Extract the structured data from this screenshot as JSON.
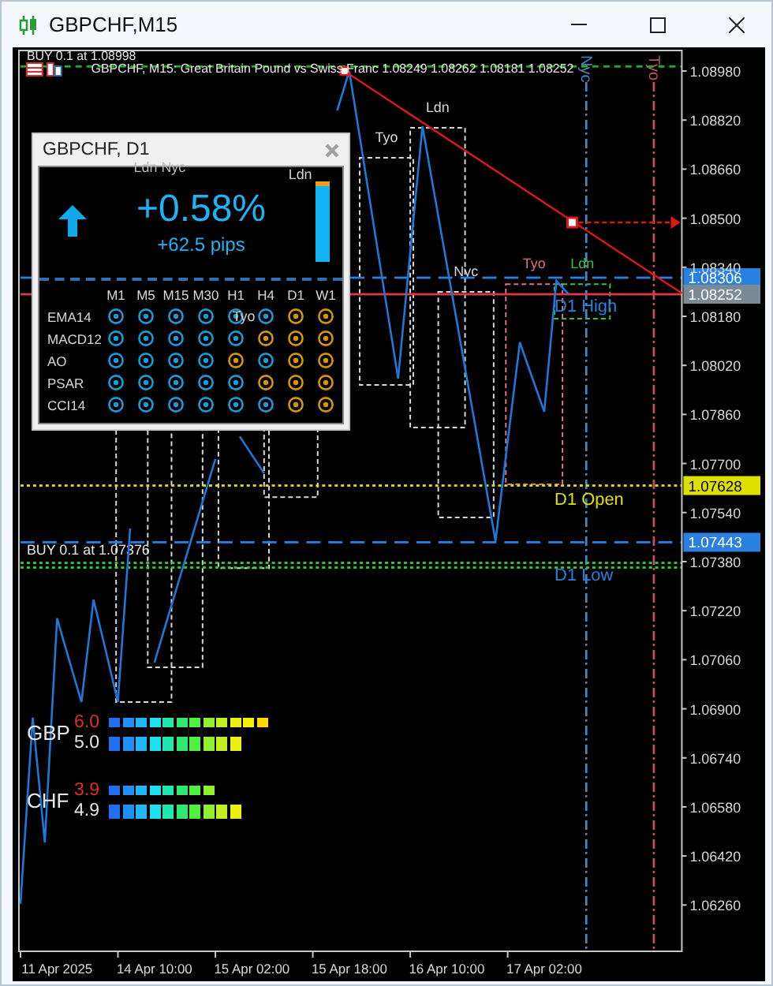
{
  "window": {
    "title": "GBPCHF,M15"
  },
  "chart": {
    "header": "GBPCHF, M15:  Great Britain Pound vs Swiss Franc  1.08249 1.08262 1.08181 1.08252",
    "chart_data": {
      "type": "line",
      "ylim": [
        1.06109,
        1.09047
      ],
      "categories": [
        null,
        null,
        null,
        "11 Apr 2025",
        null,
        null,
        null,
        null,
        null,
        null,
        null,
        "14 Apr 10:00",
        null,
        null,
        null,
        null,
        null,
        null,
        null,
        "15 Apr 02:00",
        null,
        null,
        null,
        null,
        null,
        null,
        null,
        "15 Apr 18:00",
        null,
        null,
        null,
        null,
        null,
        null,
        null,
        "16 Apr 10:00",
        null,
        null,
        null,
        null,
        null,
        null,
        null,
        "17 Apr 02:00",
        null,
        null,
        null,
        null,
        null,
        null,
        null,
        null,
        null,
        null,
        null
      ],
      "yticks": [
        {
          "value": 1.0898,
          "label": "1.08980"
        },
        {
          "value": 1.0882,
          "label": "1.08820"
        },
        {
          "value": 1.0866,
          "label": "1.08660"
        },
        {
          "value": 1.085,
          "label": "1.08500"
        },
        {
          "value": 1.0834,
          "label": "1.08340"
        },
        {
          "value": 1.0818,
          "label": "1.08180"
        },
        {
          "value": 1.0802,
          "label": "1.08020"
        },
        {
          "value": 1.0786,
          "label": "1.07860"
        },
        {
          "value": 1.077,
          "label": "1.07700"
        },
        {
          "value": 1.0754,
          "label": "1.07540"
        },
        {
          "value": 1.0738,
          "label": "1.07380"
        },
        {
          "value": 1.0722,
          "label": "1.07220"
        },
        {
          "value": 1.0706,
          "label": "1.07060"
        },
        {
          "value": 1.069,
          "label": "1.06900"
        },
        {
          "value": 1.0674,
          "label": "1.06740"
        },
        {
          "value": 1.0658,
          "label": "1.06580"
        },
        {
          "value": 1.0642,
          "label": "1.06420"
        },
        {
          "value": 1.0626,
          "label": "1.06260"
        }
      ],
      "series": [
        {
          "color": "#1e78d8",
          "values": [
            1.06264,
            1.06871,
            1.06464,
            1.07195,
            1.07059,
            1.06922,
            1.07256,
            1.07089,
            1.06922,
            1.07488,
            null,
            1.07051,
            1.07184,
            1.07317,
            1.0745,
            1.07582,
            1.07715,
            null,
            1.07788,
            1.07728,
            1.07668,
            null,
            null,
            null,
            null,
            null,
            1.08851,
            1.0898,
            1.08729,
            1.08479,
            1.08228,
            1.07977,
            1.08389,
            1.088,
            1.08575,
            1.08349,
            1.08124,
            1.07898,
            1.07673,
            1.07447,
            1.07771,
            1.08095,
            1.07982,
            1.07869,
            1.08296,
            1.08252,
            null,
            null,
            null,
            null,
            null,
            null,
            null,
            null,
            null
          ]
        }
      ]
    },
    "overlays": {
      "levels": [
        {
          "kind": "dashed",
          "color": "#22b022"
        },
        {
          "kind": "long",
          "color": "#2a80e0",
          "label": "D1 High",
          "tag": "1.08306"
        },
        {
          "kind": "solid",
          "color": "#e03848",
          "tag": "1.08252"
        },
        {
          "kind": "dotted",
          "color": "#e0e000",
          "label": "D1 Open",
          "tag": "1.07628"
        },
        {
          "kind": "long",
          "color": "#2a80e0",
          "label": "D1 Low",
          "tag": "1.07443"
        },
        {
          "kind": "double",
          "color": "#30d030",
          "label": "BUY 0.1 at 1.07376"
        }
      ],
      "sessions": [
        {
          "color": "#4a86c0",
          "label": "Nyc"
        },
        {
          "color": "#c05060",
          "label": "Tyo"
        }
      ],
      "boxes": [
        {
          "color": "#d8d8d8",
          "label": "Tyo"
        },
        {
          "color": "#d8d8d8",
          "label": "Ldn"
        },
        {
          "color": "#d8d8d8",
          "label": "Nyc"
        },
        {
          "color": "#e07080",
          "label": "Tyo"
        },
        {
          "color": "#40c040",
          "label": "Ldn"
        },
        {
          "color": "#d8d8d8"
        },
        {
          "color": "#d8d8d8"
        },
        {
          "color": "#d8d8d8"
        },
        {
          "color": "#d8d8d8"
        }
      ],
      "trend": {
        "color": "#e01818"
      },
      "order_label": "BUY 0.1 at 1.08998",
      "labels": [
        {
          "text": "Ldn Nyc",
          "color": "#b8b8b8"
        },
        {
          "text": "Ldn",
          "color": "#d0d0d0"
        },
        {
          "text": "Tyo",
          "color": "#d0d0d0"
        }
      ]
    }
  },
  "panel": {
    "title": "GBPCHF, D1",
    "change": "+0.58%",
    "pips": "+62.5 pips",
    "level": 0.94,
    "columns": [
      "M1",
      "M5",
      "M15",
      "M30",
      "H1",
      "H4",
      "D1",
      "W1"
    ],
    "rows": [
      {
        "name": "EMA14",
        "cells": [
          {
            "color": "#1c9ad6"
          },
          {
            "color": "#1c9ad6"
          },
          {
            "color": "#1c9ad6"
          },
          {
            "color": "#1c9ad6"
          },
          {
            "color": "#1c9ad6"
          },
          {
            "color": "#1c9ad6"
          },
          {
            "color": "#d4950e"
          },
          {
            "color": "#d4950e"
          }
        ]
      },
      {
        "name": "MACD12",
        "cells": [
          {
            "color": "#1c9ad6"
          },
          {
            "color": "#1c9ad6"
          },
          {
            "color": "#1c9ad6"
          },
          {
            "color": "#1c9ad6"
          },
          {
            "color": "#1c9ad6"
          },
          {
            "color": "#d4950e"
          },
          {
            "color": "#d4950e"
          },
          {
            "color": "#d4950e"
          }
        ]
      },
      {
        "name": "AO",
        "cells": [
          {
            "color": "#1c9ad6"
          },
          {
            "color": "#1c9ad6"
          },
          {
            "color": "#1c9ad6"
          },
          {
            "color": "#1c9ad6"
          },
          {
            "color": "#d4950e"
          },
          {
            "color": "#1c9ad6"
          },
          {
            "color": "#d4950e"
          },
          {
            "color": "#d4950e"
          }
        ]
      },
      {
        "name": "PSAR",
        "cells": [
          {
            "color": "#1c9ad6"
          },
          {
            "color": "#1c9ad6"
          },
          {
            "color": "#1c9ad6"
          },
          {
            "color": "#1c9ad6"
          },
          {
            "color": "#1c9ad6"
          },
          {
            "color": "#d4950e"
          },
          {
            "color": "#d4950e"
          },
          {
            "color": "#d4950e"
          }
        ]
      },
      {
        "name": "CCI14",
        "cells": [
          {
            "color": "#1c9ad6"
          },
          {
            "color": "#1c9ad6"
          },
          {
            "color": "#1c9ad6"
          },
          {
            "color": "#1c9ad6"
          },
          {
            "color": "#1c9ad6"
          },
          {
            "color": "#1c9ad6"
          },
          {
            "color": "#d4950e"
          },
          {
            "color": "#d4950e"
          }
        ]
      }
    ]
  },
  "strength": [
    {
      "currency": "GBP",
      "bars": [
        {
          "kind": "small",
          "value": "6.0",
          "segments": [
            {
              "color": "#1e70f0"
            },
            {
              "color": "#1e90f8"
            },
            {
              "color": "#20b8f8"
            },
            {
              "color": "#20e0f0"
            },
            {
              "color": "#20e8b0"
            },
            {
              "color": "#30e870"
            },
            {
              "color": "#50f040"
            },
            {
              "color": "#90f030"
            },
            {
              "color": "#c0f020"
            },
            {
              "color": "#e8f010"
            },
            {
              "color": "#f8f000"
            },
            {
              "color": "#ffd800"
            }
          ]
        },
        {
          "kind": "large",
          "value": "5.0",
          "segments": [
            {
              "color": "#1e70f0"
            },
            {
              "color": "#1e90f8"
            },
            {
              "color": "#20b8f8"
            },
            {
              "color": "#20e0f0"
            },
            {
              "color": "#20e8b0"
            },
            {
              "color": "#30e870"
            },
            {
              "color": "#50f040"
            },
            {
              "color": "#90f030"
            },
            {
              "color": "#c0f020"
            },
            {
              "color": "#e8f010"
            }
          ]
        }
      ]
    },
    {
      "currency": "CHF",
      "bars": [
        {
          "kind": "small",
          "value": "3.9",
          "segments": [
            {
              "color": "#1e70f0"
            },
            {
              "color": "#1e90f8"
            },
            {
              "color": "#20b8f8"
            },
            {
              "color": "#20e0f0"
            },
            {
              "color": "#20e8b0"
            },
            {
              "color": "#30e870"
            },
            {
              "color": "#50f040"
            },
            {
              "color": "#90f030"
            }
          ]
        },
        {
          "kind": "large",
          "value": "4.9",
          "segments": [
            {
              "color": "#1e70f0"
            },
            {
              "color": "#1e90f8"
            },
            {
              "color": "#20b8f8"
            },
            {
              "color": "#20e0f0"
            },
            {
              "color": "#20e8b0"
            },
            {
              "color": "#30e870"
            },
            {
              "color": "#50f040"
            },
            {
              "color": "#90f030"
            },
            {
              "color": "#c0f020"
            },
            {
              "color": "#e8f010"
            }
          ]
        }
      ]
    }
  ]
}
